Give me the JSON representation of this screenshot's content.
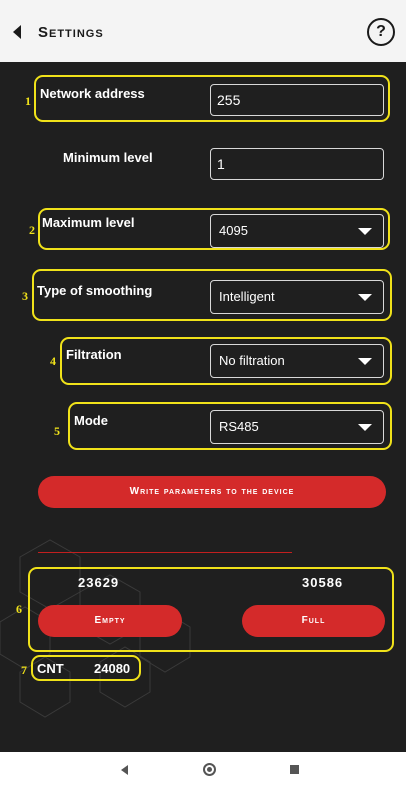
{
  "header": {
    "title": "Settings",
    "help_label": "?"
  },
  "form": {
    "network_address": {
      "label": "Network address",
      "value": "255"
    },
    "minimum_level": {
      "label": "Minimum level",
      "value": "1"
    },
    "maximum_level": {
      "label": "Maximum level",
      "value": "4095"
    },
    "smoothing": {
      "label": "Type of smoothing",
      "value": "Intelligent"
    },
    "filtration": {
      "label": "Filtration",
      "value": "No filtration"
    },
    "mode": {
      "label": "Mode",
      "value": "RS485"
    }
  },
  "write_button": "Write parameters to the device",
  "calibration": {
    "empty_value": "23629",
    "full_value": "30586",
    "empty_label": "Empty",
    "full_label": "Full"
  },
  "cnt": {
    "label": "CNT",
    "value": "24080"
  },
  "annotations": [
    "1",
    "2",
    "3",
    "4",
    "5",
    "6",
    "7"
  ],
  "colors": {
    "accent": "#d42a2a",
    "highlight": "#f0e21a",
    "background": "#1f1f1f"
  },
  "icons": {
    "back": "chevron-left-icon",
    "help": "help-icon",
    "dropdown": "caret-down-icon"
  }
}
